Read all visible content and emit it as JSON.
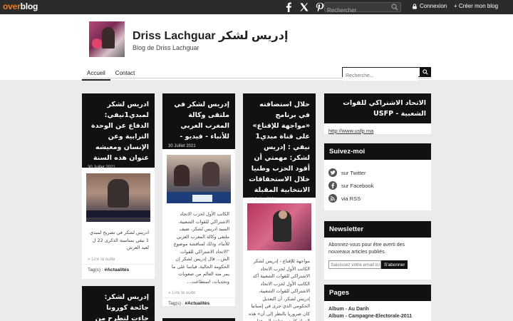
{
  "topbar": {
    "logo_over": "over",
    "logo_blog": "blog",
    "search_placeholder": "Rechercher",
    "login": "Connexion",
    "create": "+ Créer mon blog"
  },
  "header": {
    "title": "Driss Lachguar إدريس لشكر",
    "subtitle": "Blog de Driss Lachguar",
    "nav": [
      "Accueil",
      "Contact"
    ],
    "search_placeholder": "Recherche..."
  },
  "posts": [
    {
      "title": "ادريس لشكر لمبدي1نيفي: الدفاع عن الوحدة الترابية وعن الإنسان ومعيشه عنوان هذه السنة",
      "date": "30 Juillet 2021",
      "excerpt": "ادريس لشكر في تصريح لمبدي 1 نيفي بمناسبة الذكرى 22 ل لعيد العرش",
      "read_more": "» Lire la suite",
      "tags_label": "Tag(s) :",
      "tags": "#Actualités"
    },
    {
      "title": "إدريس لشكر في ملتقى وكالة المغرب العربي للأنباء - فيديو -",
      "date": "30 Juillet 2021",
      "excerpt": "الكاتب الأول لحزب الاتحاد الاشتراكي للقوات الشعبية، السيد ادريس لشكر، ضيف ملتقى وكالة المغرب العربي للأنباء، وذلك لمناقشة موضوع \"الاتحاد الاشتراكي للقوات الش... قال إدريس لشكر إن الحكومة الحالية، قياسا على ما يمر منه العالم من صعوبات وتحديات، استطاعت...",
      "read_more": "» Lire la suite",
      "tags_label": "Tag(s) :",
      "tags": "#Actualités"
    },
    {
      "title": "حلال استضافته في برنامج «مواجهة للإقناع» على قناة مبدي1 نيفي : إدريس لشكر: مهمتي أن أقود الحزب وطنيا خلال الاستحقاقات الانتخابية المقبلة",
      "date": "12 Juillet 2021",
      "excerpt": "مواجهة للإقناع - إدريس لشكر الكاتب الأول لحزب الاتحاد الاشتراكي للقوات الشعبية أكد الكاتب الأول لحزب الاتحاد الاشتراكي للقوات الشعبية، إدريس لشكر، أن التعديل الحكومي الذي جرى في إسبانيا كان ضروريا بالنظر إلى أن» هذه الدولة كانت محتاجة إلى هذا"
    },
    {
      "title": "إدريس لشكر: جائحة كورونا جاءت لتطرح من جديد القيم التي"
    }
  ],
  "sidebar": {
    "ussfp": {
      "title": "الاتحاد الاشتراكي للقوات الشعبية - USFP",
      "link": "http://www.usfp.ma"
    },
    "follow": {
      "title": "Suivez-moi",
      "items": [
        "sur Twitter",
        "sur Facebook",
        "via RSS"
      ]
    },
    "newsletter": {
      "title": "Newsletter",
      "text": "Abonnez-vous pour être averti des nouveaux articles publiés.",
      "placeholder": "Saisissez votre email ici",
      "button": "S'abonner"
    },
    "pages": {
      "title": "Pages",
      "items": [
        "Album - Au Darih",
        "Album - Campagne-Electorale-2011"
      ]
    }
  }
}
